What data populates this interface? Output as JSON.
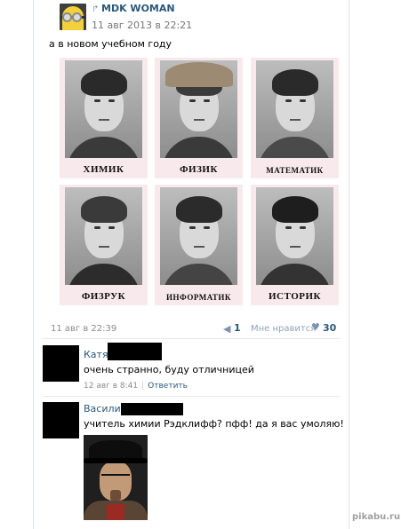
{
  "post": {
    "author": "MDK WOMAN",
    "date": "11 авг 2013 в 22:21",
    "text": "а в новом учебном году",
    "grid": [
      {
        "label": "ХИМИК",
        "hat": false
      },
      {
        "label": "ФИЗИК",
        "hat": true
      },
      {
        "label": "МАТЕМАТИК",
        "hat": false
      },
      {
        "label": "ФИЗРУК",
        "hat": false
      },
      {
        "label": "ИНФОРМАТИК",
        "hat": false
      },
      {
        "label": "ИСТОРИК",
        "hat": false
      }
    ],
    "footer": {
      "date": "11 авг в 22:39",
      "share_count": "1",
      "like_label": "Мне нравится",
      "like_count": "30"
    }
  },
  "comments": [
    {
      "name": "Катя",
      "text": "очень странно, буду отличницей",
      "date": "12 авг в 8:41",
      "reply_label": "Ответить"
    },
    {
      "name": "Василий",
      "text": "учитель химии Рэдклифф? пфф! да я вас умоляю!"
    }
  ],
  "icons": {
    "repost": "repost-arrow-icon",
    "share": "megaphone-icon",
    "like": "heart-icon"
  },
  "colors": {
    "link": "#2b587a",
    "muted": "#8b8b8b",
    "card_bg": "#f7e9ec"
  },
  "watermark": "pikabu.ru"
}
